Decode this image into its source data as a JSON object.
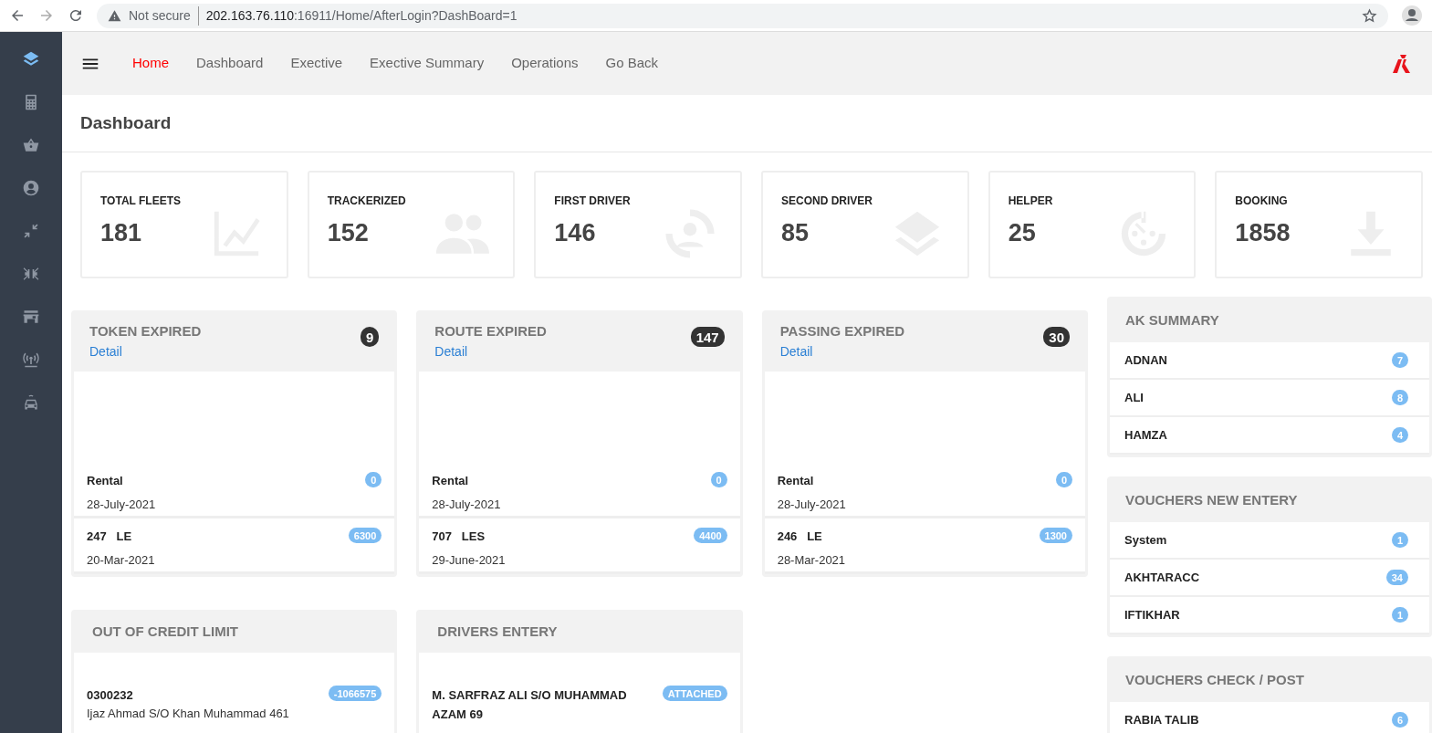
{
  "browser": {
    "security": "Not secure",
    "url_host": "202.163.76.110",
    "url_rest": ":16911/Home/AfterLogin?DashBoard=1"
  },
  "sidebar": [
    {
      "selected": true
    },
    {
      "selected": false
    },
    {
      "selected": false
    },
    {
      "selected": false
    },
    {
      "selected": false
    },
    {
      "selected": false
    },
    {
      "selected": false
    },
    {
      "selected": false
    },
    {
      "selected": false
    }
  ],
  "nav": [
    {
      "label": "Home",
      "selected": true
    },
    {
      "label": "Dashboard",
      "selected": false
    },
    {
      "label": "Exective",
      "selected": false
    },
    {
      "label": "Exective Summary",
      "selected": false
    },
    {
      "label": "Operations",
      "selected": false
    },
    {
      "label": "Go Back",
      "selected": false
    }
  ],
  "page_title": "Dashboard",
  "stats": [
    {
      "label": "TOTAL FLEETS",
      "value": "181"
    },
    {
      "label": "TRACKERIZED",
      "value": "152"
    },
    {
      "label": "FIRST DRIVER",
      "value": "146"
    },
    {
      "label": "SECOND DRIVER",
      "value": "85"
    },
    {
      "label": "HELPER",
      "value": "25"
    },
    {
      "label": "BOOKING",
      "value": "1858"
    }
  ],
  "expired_panels": [
    {
      "title": "TOKEN EXPIRED",
      "link": "Detail",
      "count": "9",
      "rows": [
        {
          "name": "Rental",
          "date": "28-July-2021",
          "badge": "0"
        },
        {
          "name": "247   LE",
          "date": "20-Mar-2021",
          "badge": "6300"
        }
      ]
    },
    {
      "title": "ROUTE EXPIRED",
      "link": "Detail",
      "count": "147",
      "rows": [
        {
          "name": "Rental",
          "date": "28-July-2021",
          "badge": "0"
        },
        {
          "name": "707   LES",
          "date": "29-June-2021",
          "badge": "4400"
        }
      ]
    },
    {
      "title": "PASSING EXPIRED",
      "link": "Detail",
      "count": "30",
      "rows": [
        {
          "name": "Rental",
          "date": "28-July-2021",
          "badge": "0"
        },
        {
          "name": "246   LE",
          "date": "28-Mar-2021",
          "badge": "1300"
        }
      ]
    }
  ],
  "bottom_panels": [
    {
      "title": "OUT OF CREDIT LIMIT",
      "rows": [
        {
          "name": "0300232",
          "detail": "Ijaz Ahmad S/O Khan Muhammad 461",
          "badge": "-1066575"
        }
      ]
    },
    {
      "title": "DRIVERS ENTERY",
      "rows": [
        {
          "name": "M. SARFRAZ ALI S/O MUHAMMAD AZAM 69",
          "badge": "ATTACHED"
        }
      ]
    }
  ],
  "side_panels": [
    {
      "title": "AK SUMMARY",
      "rows": [
        {
          "name": "ADNAN",
          "count": "7"
        },
        {
          "name": "ALI",
          "count": "8"
        },
        {
          "name": "HAMZA",
          "count": "4"
        }
      ]
    },
    {
      "title": "VOUCHERS NEW ENTERY",
      "rows": [
        {
          "name": "System",
          "count": "1"
        },
        {
          "name": "AKHTARACC",
          "count": "34"
        },
        {
          "name": "IFTIKHAR",
          "count": "1"
        }
      ]
    },
    {
      "title": "VOUCHERS CHECK / POST",
      "rows": [
        {
          "name": "RABIA TALIB",
          "count": "6"
        }
      ]
    }
  ]
}
